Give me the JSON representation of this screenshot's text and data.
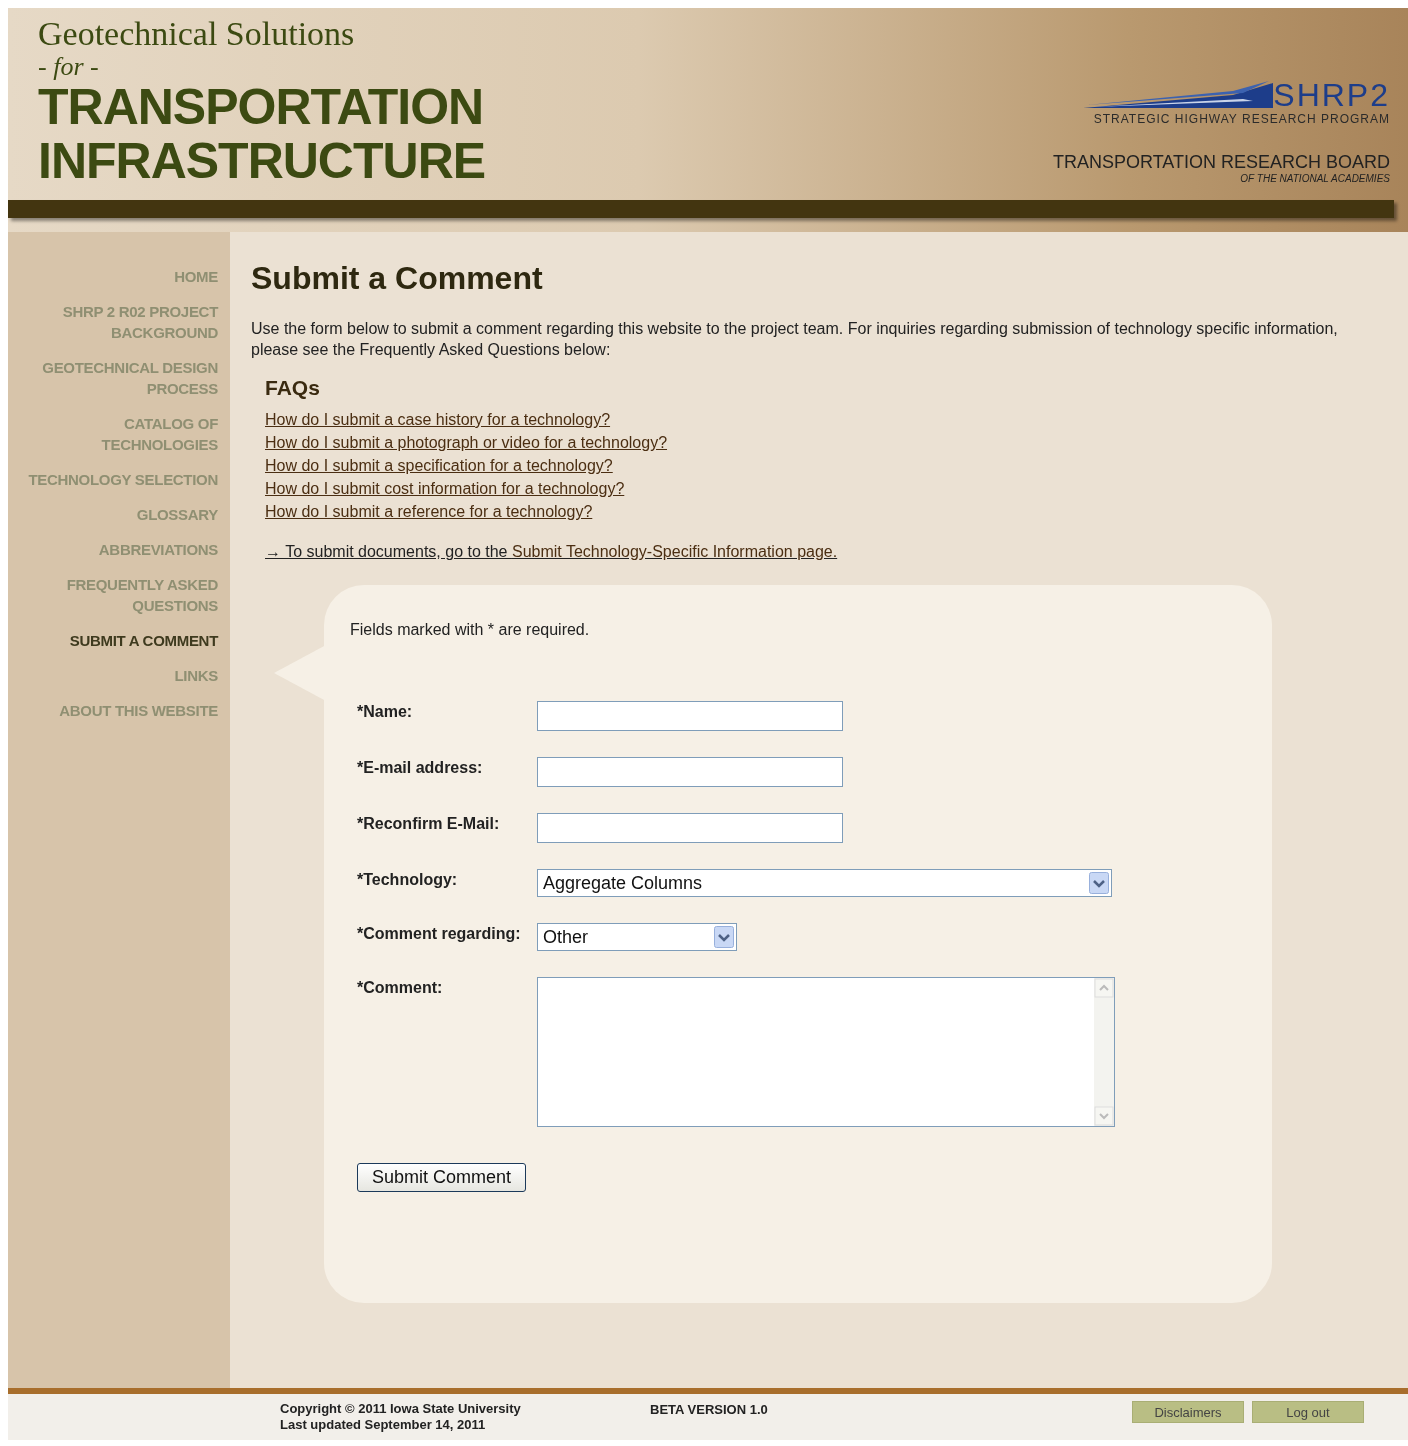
{
  "header": {
    "title_lines": [
      "Geotechnical Solutions",
      "- for -",
      "TRANSPORTATION",
      "INFRASTRUCTURE"
    ],
    "logo": {
      "name": "SHRP2",
      "subtitle": "STRATEGIC HIGHWAY RESEARCH PROGRAM"
    },
    "org": {
      "name": "TRANSPORTATION RESEARCH BOARD",
      "subtitle": "OF THE NATIONAL ACADEMIES"
    }
  },
  "nav": {
    "items": [
      {
        "label": "HOME",
        "selected": false
      },
      {
        "label": "SHRP 2 R02 PROJECT BACKGROUND",
        "selected": false
      },
      {
        "label": "GEOTECHNICAL DESIGN PROCESS",
        "selected": false
      },
      {
        "label": "CATALOG OF TECHNOLOGIES",
        "selected": false
      },
      {
        "label": "TECHNOLOGY SELECTION",
        "selected": false
      },
      {
        "label": "GLOSSARY",
        "selected": false
      },
      {
        "label": "ABBREVIATIONS",
        "selected": false
      },
      {
        "label": "FREQUENTLY ASKED QUESTIONS",
        "selected": false
      },
      {
        "label": "SUBMIT A COMMENT",
        "selected": true
      },
      {
        "label": "LINKS",
        "selected": false
      },
      {
        "label": "ABOUT THIS WEBSITE",
        "selected": false
      }
    ]
  },
  "page": {
    "title": "Submit a Comment",
    "intro": "Use the form below to submit a comment regarding this website to the project team. For inquiries regarding submission of technology specific information, please see the Frequently Asked Questions below:",
    "faqs_heading": "FAQs",
    "faqs": [
      "How do I submit a case history for a technology?",
      "How do I submit a photograph or video for a technology?",
      "How do I submit a specification for a technology?",
      "How do I submit cost information for a technology?",
      "How do I submit a reference for a technology?"
    ],
    "submit_docs": {
      "text": "→ To submit documents, go to the ",
      "link": "Submit Technology-Specific Information page."
    }
  },
  "form": {
    "note": "Fields marked with * are required.",
    "fields": [
      {
        "label": "*Name:",
        "kind": "text"
      },
      {
        "label": "*E-mail address:",
        "kind": "text"
      },
      {
        "label": "*Reconfirm E-Mail:",
        "kind": "text"
      },
      {
        "label": "*Technology:",
        "kind": "select",
        "value": "Aggregate Columns"
      },
      {
        "label": "*Comment regarding:",
        "kind": "select",
        "value": "Other"
      },
      {
        "label": "*Comment:",
        "kind": "textarea"
      }
    ],
    "submit_button": "Submit Comment"
  },
  "footer": {
    "copyright": "Copyright © 2011 Iowa State University",
    "updated": "Last updated September 14, 2011",
    "version": "BETA VERSION 1.0",
    "buttons": [
      "Disclaimers",
      "Log out"
    ]
  }
}
